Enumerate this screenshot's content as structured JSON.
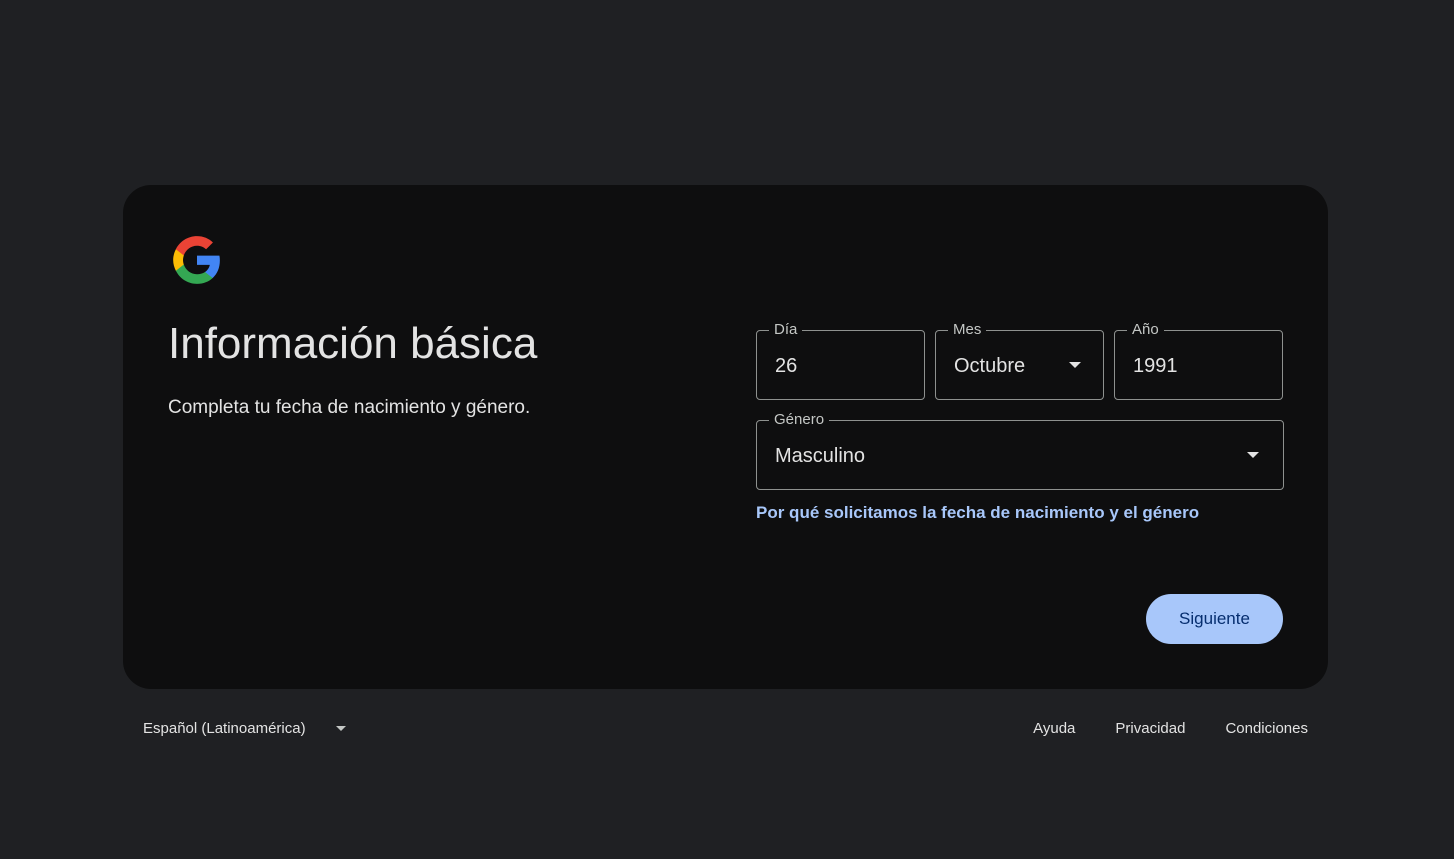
{
  "header": {
    "logo_icon": "google-g-logo",
    "title": "Información básica",
    "subtitle": "Completa tu fecha de nacimiento y género."
  },
  "form": {
    "day": {
      "label": "Día",
      "value": "26"
    },
    "month": {
      "label": "Mes",
      "value": "Octubre",
      "icon": "caret-down-icon"
    },
    "year": {
      "label": "Año",
      "value": "1991"
    },
    "gender": {
      "label": "Género",
      "value": "Masculino",
      "icon": "caret-down-icon"
    },
    "why_link": "Por qué solicitamos la fecha de nacimiento y el género",
    "next_button": "Siguiente"
  },
  "footer": {
    "language": "Español (Latinoamérica)",
    "links": [
      "Ayuda",
      "Privacidad",
      "Condiciones"
    ]
  },
  "colors": {
    "page_bg": "#1f2023",
    "card_bg": "#0e0e0f",
    "accent": "#a8c7fa",
    "button_text": "#062e6f",
    "border": "#8e918f"
  }
}
